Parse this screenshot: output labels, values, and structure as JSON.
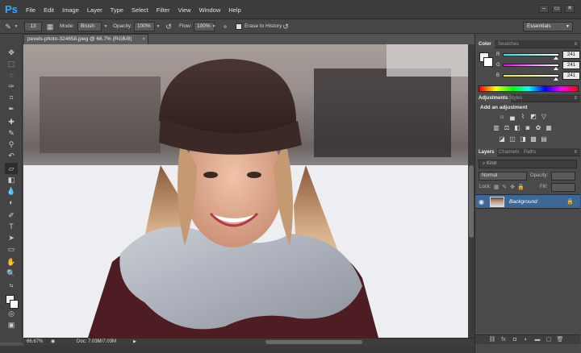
{
  "app": {
    "logo": "Ps"
  },
  "menu": [
    "File",
    "Edit",
    "Image",
    "Layer",
    "Type",
    "Select",
    "Filter",
    "View",
    "Window",
    "Help"
  ],
  "window_controls": [
    "–",
    "▭",
    "✕"
  ],
  "options": {
    "brush_size": "13",
    "mode_label": "Mode:",
    "mode_value": "Brush",
    "opacity_label": "Opacity:",
    "opacity_value": "100%",
    "flow_label": "Flow:",
    "flow_value": "100%",
    "erase_history_label": "Erase to History",
    "workspace": "Essentials"
  },
  "document": {
    "tab_title": "pexels-photo-324658.jpeg @ 66.7% (RGB/8)",
    "close": "×",
    "zoom": "66.67%",
    "doc_info": "Doc: 7.03M/7.03M"
  },
  "color_panel": {
    "tabs": [
      "Color",
      "Swatches"
    ],
    "r_label": "R",
    "g_label": "G",
    "b_label": "B",
    "r_value": "241",
    "g_value": "241",
    "b_value": "241",
    "level": 0.945
  },
  "adjustments_panel": {
    "tabs": [
      "Adjustments",
      "Styles"
    ],
    "title": "Add an adjustment"
  },
  "layers_panel": {
    "tabs": [
      "Layers",
      "Channels",
      "Paths"
    ],
    "filter_label": "Kind",
    "blend_mode": "Normal",
    "opacity_label": "Opacity:",
    "lock_label": "Lock:",
    "fill_label": "Fill:",
    "layer_name": "Background"
  },
  "icons": {
    "eye": "eye-icon",
    "lock": "lock-icon"
  }
}
